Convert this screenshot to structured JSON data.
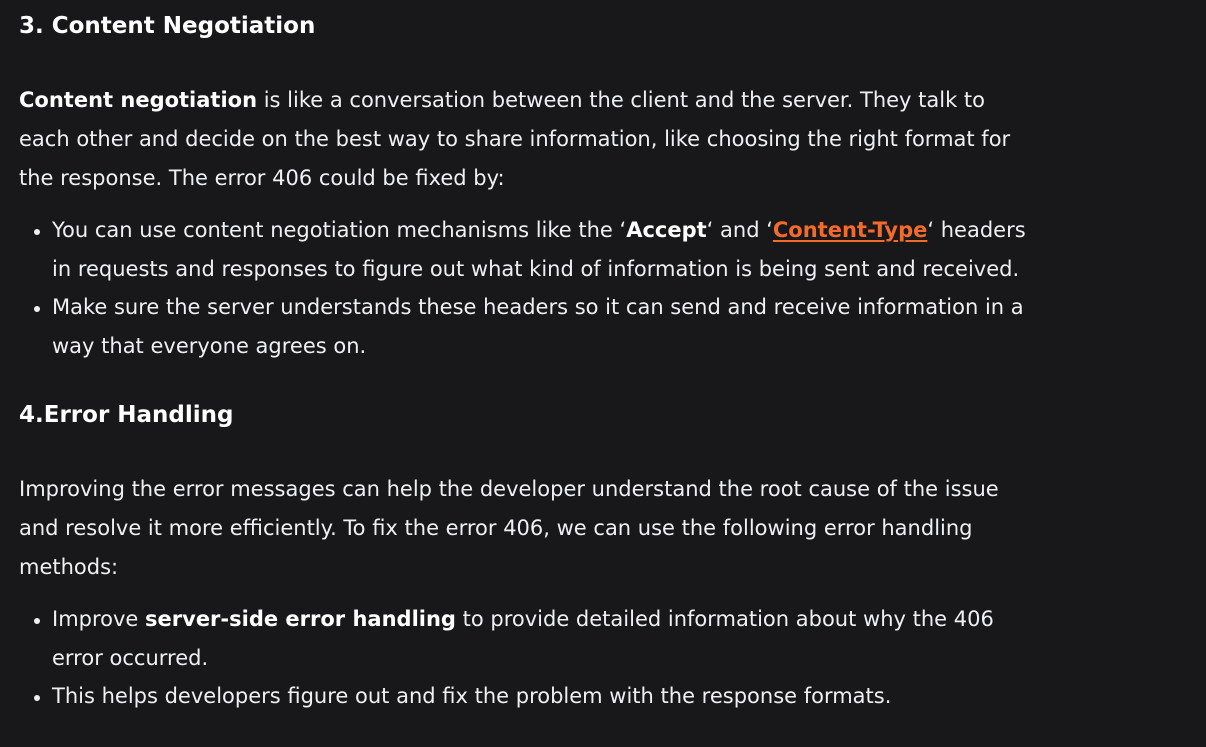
{
  "section3": {
    "heading": "3. Content Negotiation",
    "intro_bold": "Content negotiation",
    "intro_line1_rest": " is like a conversation between the client and the server. They talk to",
    "intro_line2": "each other and decide on the best way to share information, like choosing the right format for",
    "intro_line3": "the response. The error 406 could be fixed by:",
    "bullet1_pre": "You can use content negotiation mechanisms like the ‘",
    "bullet1_accept": "Accept",
    "bullet1_mid": "‘ and ‘",
    "bullet1_link": "Content-Type",
    "bullet1_post": "‘ headers",
    "bullet1_line2": "in requests and responses to figure out what kind of information is being sent and received.",
    "bullet2_line1": "Make sure the server understands these headers so it can send and receive information in a",
    "bullet2_line2": "way that everyone agrees on."
  },
  "section4": {
    "heading": "4.Error Handling",
    "intro_line1": "Improving the error messages can help the developer understand the root cause of the issue",
    "intro_line2": "and resolve it more efficiently. To fix the error 406, we can use the following error handling",
    "intro_line3": "methods:",
    "bullet1_pre": "Improve ",
    "bullet1_bold": "server-side error handling",
    "bullet1_post": " to provide detailed information about why the 406",
    "bullet1_line2": "error occurred.",
    "bullet2": "This helps developers figure out and fix the problem with the response formats."
  },
  "colors": {
    "background": "#18181a",
    "text": "#eef0f3",
    "link": "#f26b2a"
  }
}
